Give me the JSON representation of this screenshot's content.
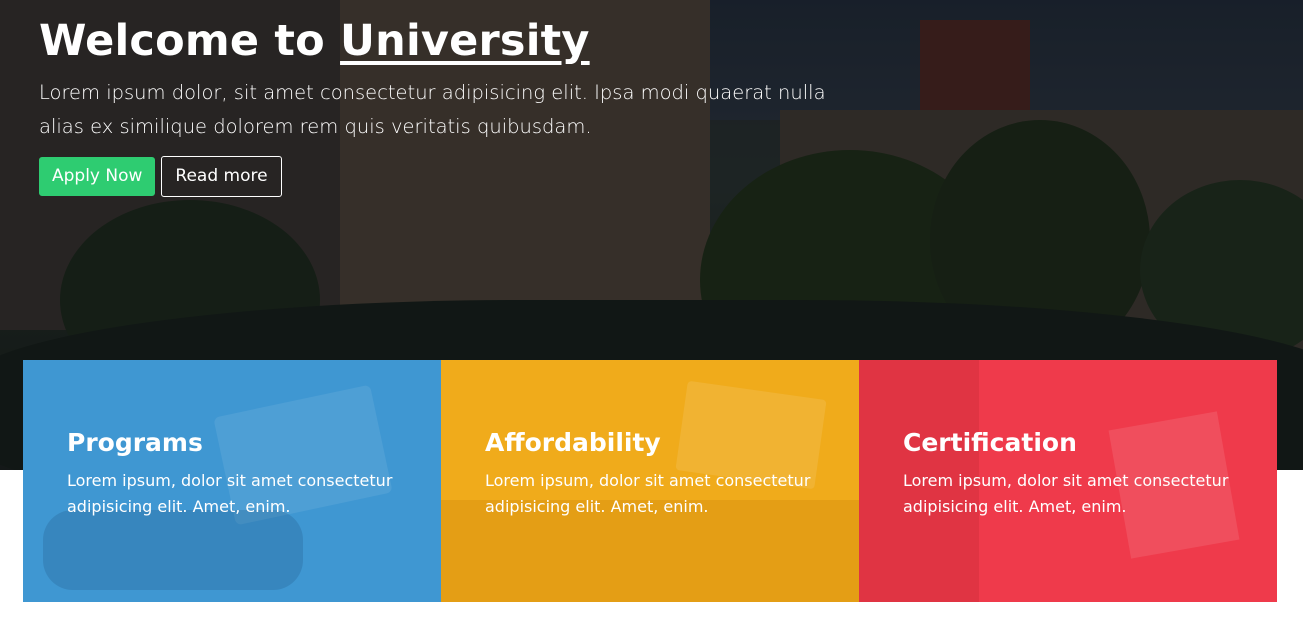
{
  "hero": {
    "title_prefix": "Welcome to ",
    "title_link": "University",
    "text": "Lorem ipsum dolor, sit amet consectetur adipisicing elit. Ipsa modi quaerat nulla alias ex similique dolorem rem quis veritatis quibusdam.",
    "apply_label": "Apply Now",
    "read_label": "Read more"
  },
  "cards": [
    {
      "title": "Programs",
      "text": "Lorem ipsum, dolor sit amet consectetur adipisicing elit. Amet, enim.",
      "color": "#3f97d2"
    },
    {
      "title": "Affordability",
      "text": "Lorem ipsum, dolor sit amet consectetur adipisicing elit. Amet, enim.",
      "color": "#f0ab1b"
    },
    {
      "title": "Certification",
      "text": "Lorem ipsum, dolor sit amet consectetur adipisicing elit. Amet, enim.",
      "color": "#ef3a4b"
    }
  ],
  "colors": {
    "apply_button": "#2ecc71",
    "overlay": "#0a0c10"
  }
}
